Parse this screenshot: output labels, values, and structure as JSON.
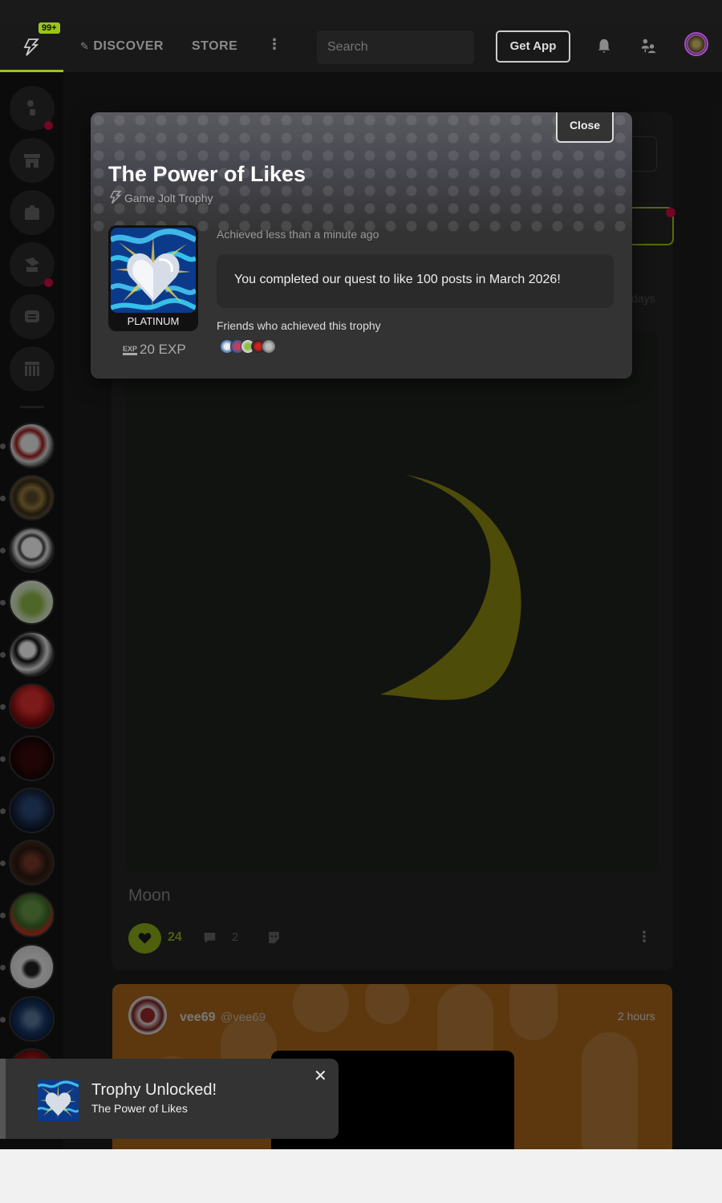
{
  "header": {
    "badge": "99+",
    "nav": [
      {
        "label": "DISCOVER"
      },
      {
        "label": "STORE"
      }
    ],
    "more": "⋮",
    "search_placeholder": "Search",
    "get_app": "Get App"
  },
  "feed": {
    "ghost_time": "days",
    "post": {
      "title": "Moon",
      "likes": "24",
      "comments": "2",
      "menu": "⋮"
    },
    "next_post": {
      "username": "vee69",
      "handle": "@vee69",
      "time": "2 hours"
    }
  },
  "modal": {
    "close": "Close",
    "title": "The Power of Likes",
    "subtitle": "Game Jolt Trophy",
    "tier": "PLATINUM",
    "exp_tag": "EXP",
    "exp": "20 EXP",
    "achieved": "Achieved less than a minute ago",
    "description": "You completed our quest to like 100 posts in March 2026!",
    "friends_label": "Friends who achieved this trophy"
  },
  "toast": {
    "title": "Trophy Unlocked!",
    "subtitle": "The Power of Likes",
    "close": "✕"
  },
  "colors": {
    "accent": "#9bc41b",
    "alert": "#d10a45",
    "moon": "#8e8a12"
  }
}
